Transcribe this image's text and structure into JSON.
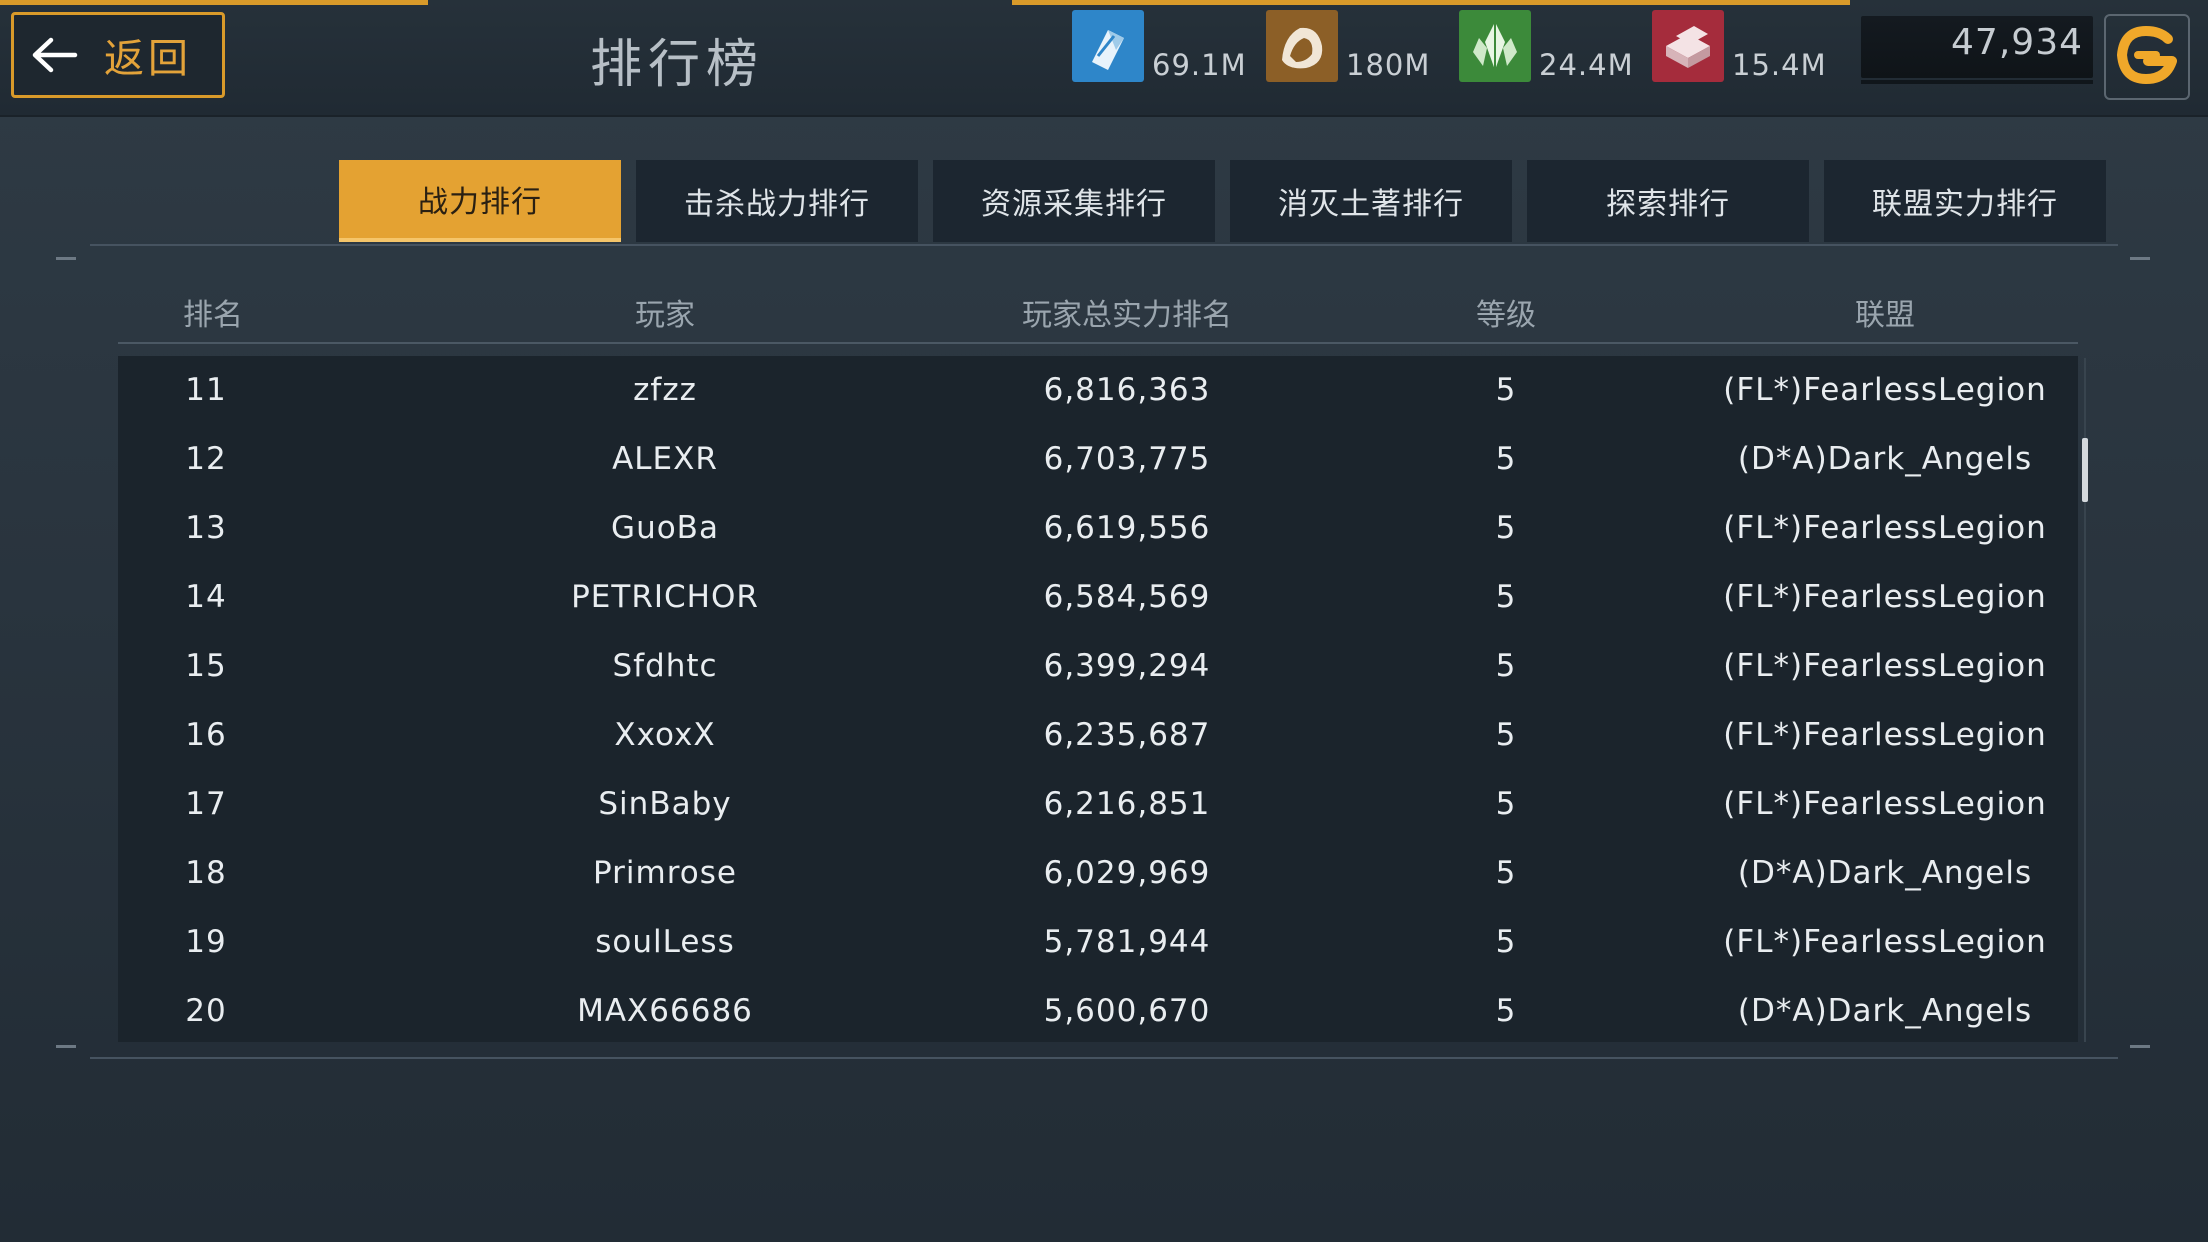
{
  "header": {
    "back_label": "返回",
    "title": "排行榜"
  },
  "resources": [
    {
      "name": "iron",
      "icon": "crystal-shard-icon",
      "value": "69.1M",
      "color": "#2e86c9"
    },
    {
      "name": "stone",
      "icon": "ore-rock-icon",
      "value": "180M",
      "color": "#9a6a2c"
    },
    {
      "name": "crystal",
      "icon": "green-crystal-icon",
      "value": "24.4M",
      "color": "#3c8a3a"
    },
    {
      "name": "alloy",
      "icon": "metal-ingot-icon",
      "value": "15.4M",
      "color": "#a52c3c"
    }
  ],
  "gold": {
    "value": "47,934",
    "icon": "add-gold-icon"
  },
  "colors": {
    "accent": "#e4a232",
    "tab_bg": "#1c2630",
    "table_bg": "#1b242c"
  },
  "tabs": [
    {
      "label": "战力排行",
      "active": true
    },
    {
      "label": "击杀战力排行",
      "active": false
    },
    {
      "label": "资源采集排行",
      "active": false
    },
    {
      "label": "消灭土著排行",
      "active": false
    },
    {
      "label": "探索排行",
      "active": false
    },
    {
      "label": "联盟实力排行",
      "active": false
    }
  ],
  "table": {
    "columns": [
      "排名",
      "玩家",
      "玩家总实力排名",
      "等级",
      "联盟"
    ],
    "rows": [
      [
        "11",
        "zfzz",
        "6,816,363",
        "5",
        "(FL*)FearlessLegion"
      ],
      [
        "12",
        "ALEXR",
        "6,703,775",
        "5",
        "(D*A)Dark_Angels"
      ],
      [
        "13",
        "GuoBa",
        "6,619,556",
        "5",
        "(FL*)FearlessLegion"
      ],
      [
        "14",
        "PETRICHOR",
        "6,584,569",
        "5",
        "(FL*)FearlessLegion"
      ],
      [
        "15",
        "Sfdhtc",
        "6,399,294",
        "5",
        "(FL*)FearlessLegion"
      ],
      [
        "16",
        "XxoxX",
        "6,235,687",
        "5",
        "(FL*)FearlessLegion"
      ],
      [
        "17",
        "SinBaby",
        "6,216,851",
        "5",
        "(FL*)FearlessLegion"
      ],
      [
        "18",
        "Primrose",
        "6,029,969",
        "5",
        "(D*A)Dark_Angels"
      ],
      [
        "19",
        "soulLess",
        "5,781,944",
        "5",
        "(FL*)FearlessLegion"
      ],
      [
        "20",
        "MAX66686",
        "5,600,670",
        "5",
        "(D*A)Dark_Angels"
      ]
    ]
  }
}
